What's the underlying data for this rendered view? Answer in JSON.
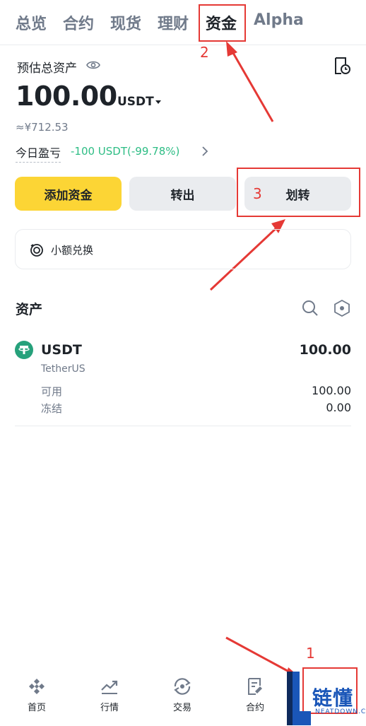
{
  "tabs": [
    {
      "label": "总览"
    },
    {
      "label": "合约"
    },
    {
      "label": "现货"
    },
    {
      "label": "理财"
    },
    {
      "label": "资金",
      "active": true
    },
    {
      "label": "Alpha"
    }
  ],
  "annotations": [
    "1",
    "2",
    "3"
  ],
  "overview": {
    "label": "预估总资产",
    "total": "100.00",
    "currency": "USDT",
    "approx": "≈¥712.53",
    "pnl_label": "今日盈亏",
    "pnl_value": "-100 USDT(-99.78%)"
  },
  "actions": {
    "add": "添加资金",
    "withdraw": "转出",
    "transfer": "划转"
  },
  "convert": {
    "label": "小额兑换"
  },
  "assets": {
    "title": "资产",
    "items": [
      {
        "symbol": "USDT",
        "name": "TetherUS",
        "total": "100.00",
        "available_label": "可用",
        "available": "100.00",
        "frozen_label": "冻结",
        "frozen": "0.00"
      }
    ]
  },
  "nav": [
    {
      "label": "首页",
      "icon": "home-icon"
    },
    {
      "label": "行情",
      "icon": "markets-icon"
    },
    {
      "label": "交易",
      "icon": "trade-icon"
    },
    {
      "label": "合约",
      "icon": "futures-icon"
    }
  ],
  "watermark": {
    "text": "链懂",
    "sub": "NEATDOWN.COM"
  },
  "colors": {
    "accent": "#fcd535",
    "positive": "#2ebd85",
    "annotation": "#e53935",
    "watermark": "#1a56b8"
  }
}
